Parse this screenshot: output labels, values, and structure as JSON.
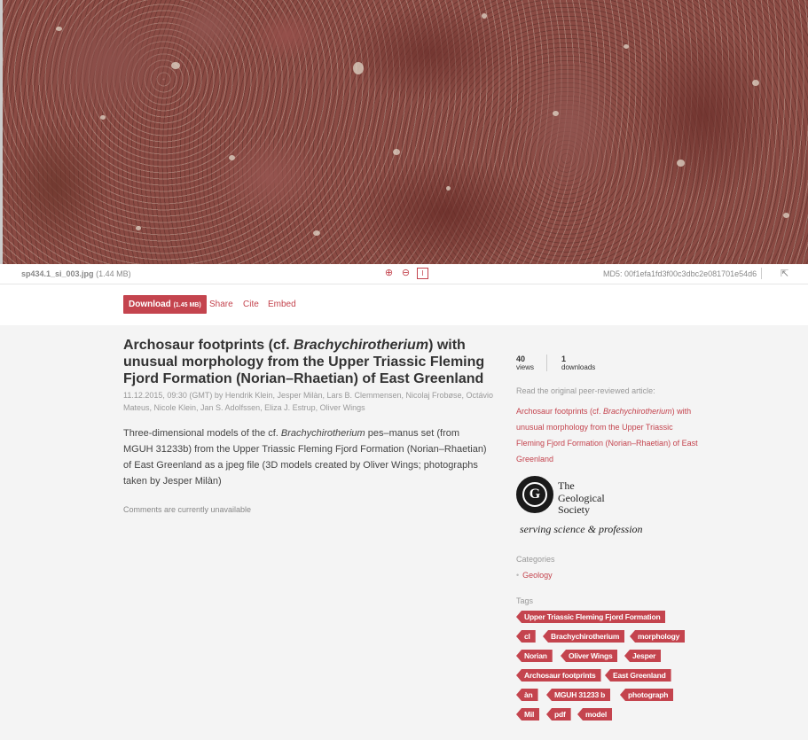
{
  "file": {
    "name": "sp434.1_si_003.jpg",
    "size": "(1.44 MB)",
    "md5": "MD5: 00f1efa1fd3f00c3dbc2e081701e54d6"
  },
  "actions": {
    "download_label": "Download",
    "download_size": "(1.45 MB)",
    "share": "Share",
    "cite": "Cite",
    "embed": "Embed"
  },
  "article": {
    "title_pre": "Archosaur footprints (cf. ",
    "title_italic": "Brachychirotherium",
    "title_post": ") with unusual morphology from the Upper Triassic Fleming Fjord Formation (Norian–Rhaetian) of East Greenland",
    "date_by": "11.12.2015, 09:30 (GMT) by",
    "authors": "Hendrik Klein,  Jesper Milàn,  Lars B. Clemmensen,  Nicolaj Frobøse,  Octávio Mateus,  Nicole Klein,  Jan S. Adolfssen,  Eliza J. Estrup,  Oliver Wings",
    "desc_pre": "Three-dimensional models of the cf. ",
    "desc_italic": "Brachychirotherium",
    "desc_post": " pes–manus set (from MGUH 31233b) from the Upper Triassic Fleming Fjord Formation (Norian–Rhaetian) of East Greenland as a jpeg file (3D models created by Oliver Wings; photographs taken by Jesper Milàn)",
    "comments": "Comments are currently unavailable"
  },
  "sidebar": {
    "views_count": "40",
    "views_label": "views",
    "downloads_count": "1",
    "downloads_label": "downloads",
    "read_original": "Read the original peer-reviewed article:",
    "link_pre": "Archosaur footprints (cf. ",
    "link_italic": "Brachychirotherium",
    "link_post": ") with unusual morphology from the Upper Triassic Fleming Fjord Formation (Norian–Rhaetian) of East Greenland",
    "publisher": {
      "line1": "The",
      "line2": "Geological",
      "line3": "Society",
      "tagline": "serving science & profession"
    },
    "categories_label": "Categories",
    "category": "Geology",
    "tags_label": "Tags",
    "tags": [
      [
        "Upper Triassic Fleming Fjord Formation"
      ],
      [
        "cl",
        "Brachychirotherium",
        "morphology"
      ],
      [
        "Norian",
        "Oliver Wings",
        "Jesper"
      ],
      [
        "Archosaur footprints",
        "East Greenland"
      ],
      [
        "àn",
        "MGUH 31233 b",
        "photograph"
      ],
      [
        "Mil",
        "pdf",
        "model"
      ]
    ]
  },
  "colors": {
    "accent": "#c4444e"
  },
  "icons": [
    "zoom-in-icon",
    "zoom-out-icon",
    "fit-icon",
    "exit-fullscreen-icon"
  ]
}
